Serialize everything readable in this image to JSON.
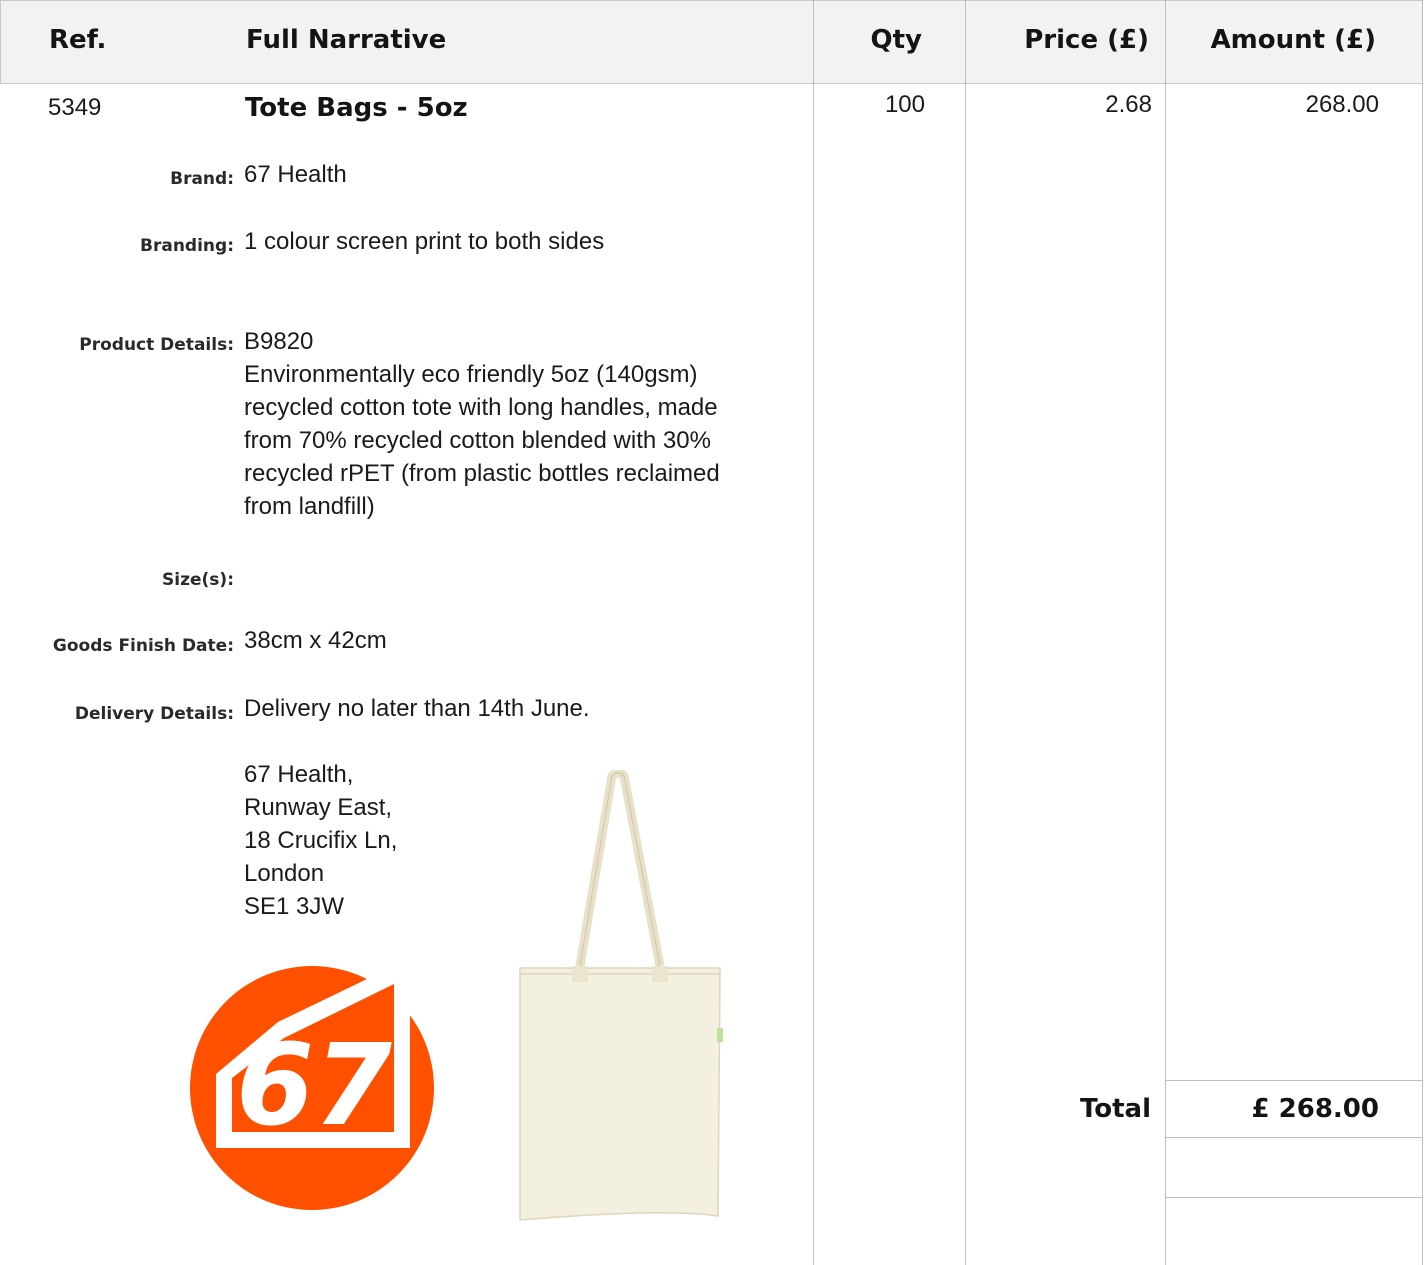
{
  "columns": {
    "ref": "Ref.",
    "narrative": "Full Narrative",
    "qty": "Qty",
    "price": "Price (£)",
    "amount": "Amount (£)"
  },
  "item": {
    "ref": "5349",
    "title": "Tote Bags - 5oz",
    "qty": "100",
    "price": "2.68",
    "amount": "268.00",
    "fields": {
      "brand_label": "Brand:",
      "brand_value": "67 Health",
      "branding_label": "Branding:",
      "branding_value": "1 colour screen print to both sides",
      "product_label": "Product Details:",
      "product_code": "B9820",
      "product_desc_lines": [
        "Environmentally eco friendly 5oz (140gsm)",
        "recycled cotton tote with long handles, made",
        "from 70% recycled cotton blended with 30%",
        "recycled rPET (from plastic bottles reclaimed",
        "from landfill)"
      ],
      "sizes_label": "Size(s):",
      "sizes_value": "",
      "finish_label": "Goods Finish Date:",
      "finish_value": "38cm x 42cm",
      "delivery_label": "Delivery Details:",
      "delivery_value": "Delivery no later than 14th June.",
      "address_lines": [
        "67 Health,",
        "Runway East,",
        "18 Crucifix Ln,",
        "London",
        "SE1 3JW"
      ]
    },
    "logo_text": "67"
  },
  "totals": {
    "label": "Total",
    "value": "£ 268.00"
  },
  "colors": {
    "header_bg": "#f2f2f2",
    "grid": "#bdbdbd",
    "logo_orange": "#ff5000",
    "bag_fill": "#f3efdf"
  },
  "icons": {
    "logo": "67-health-logo",
    "product": "tote-bag-image"
  }
}
